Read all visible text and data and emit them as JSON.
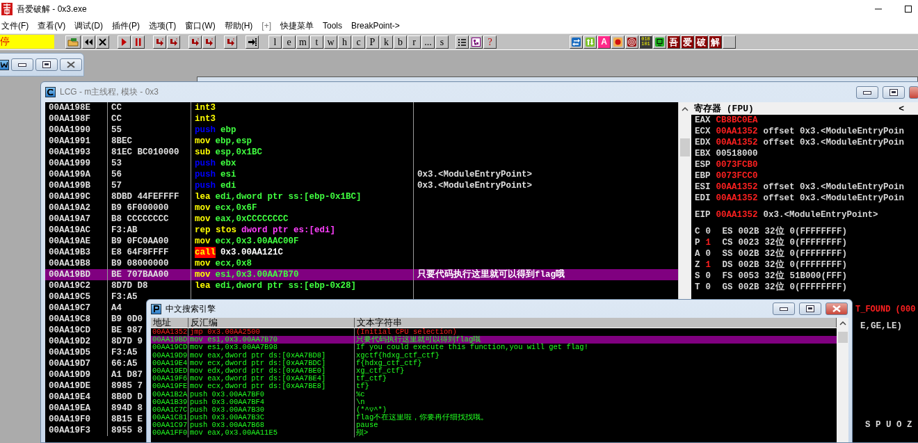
{
  "app": {
    "title": "吾爱破解 - 0x3.exe"
  },
  "menu": [
    "文件(F)",
    "查看(V)",
    "调试(D)",
    "插件(P)",
    "选项(T)",
    "窗口(W)",
    "帮助(H)",
    "[+]",
    "快捷菜单",
    "Tools",
    "BreakPoint->"
  ],
  "toolbar": {
    "status": "停",
    "letters": [
      "l",
      "e",
      "m",
      "t",
      "w",
      "h",
      "c",
      "P",
      "k",
      "b",
      "r",
      "...",
      "s"
    ],
    "help": "?",
    "letter_icon": "A",
    "binary": [
      "010",
      "101"
    ],
    "brand": [
      "吾",
      "爱",
      "破",
      "解"
    ]
  },
  "cpu_window": {
    "title": "LCG - m主线程, 模块 - 0x3",
    "rows": [
      {
        "address": "00AA198E",
        "hex": "CC",
        "op": "int3",
        "kind": "plain",
        "selected": false
      },
      {
        "address": "00AA198F",
        "hex": "CC",
        "op": "int3",
        "kind": "plain",
        "selected": false
      },
      {
        "address": "00AA1990",
        "hex": "55",
        "op": "push",
        "args": "ebp",
        "kind": "stack",
        "selected": false
      },
      {
        "address": "00AA1991",
        "hex": "8BEC",
        "op": "mov",
        "args": "ebp,esp",
        "kind": "plain",
        "selected": false
      },
      {
        "address": "00AA1993",
        "hex": "81EC BC010000",
        "op": "sub",
        "args": "esp,0x1BC",
        "kind": "plain",
        "selected": false
      },
      {
        "address": "00AA1999",
        "hex": "53",
        "op": "push",
        "args": "ebx",
        "kind": "stack",
        "selected": false
      },
      {
        "address": "00AA199A",
        "hex": "56",
        "op": "push",
        "args": "esi",
        "kind": "stack",
        "comment": "0x3.<ModuleEntryPoint>",
        "selected": false
      },
      {
        "address": "00AA199B",
        "hex": "57",
        "op": "push",
        "args": "edi",
        "kind": "stack",
        "comment": "0x3.<ModuleEntryPoint>",
        "selected": false
      },
      {
        "address": "00AA199C",
        "hex": "8DBD 44FEFFFF",
        "op": "lea",
        "args": "edi,dword ptr ss:[ebp-0x1BC]",
        "kind": "plain",
        "selected": false
      },
      {
        "address": "00AA19A2",
        "hex": "B9 6F000000",
        "op": "mov",
        "args": "ecx,0x6F",
        "kind": "plain",
        "selected": false
      },
      {
        "address": "00AA19A7",
        "hex": "B8 CCCCCCCC",
        "op": "mov",
        "args": "eax,0xCCCCCCCC",
        "kind": "plain",
        "selected": false
      },
      {
        "address": "00AA19AC",
        "hex": "F3:AB",
        "op": "rep stos",
        "args": "dword ptr es:[edi]",
        "kind": "string",
        "selected": false
      },
      {
        "address": "00AA19AE",
        "hex": "B9 0FC0AA00",
        "op": "mov",
        "args": "ecx,0x3.00AAC00F",
        "kind": "plain",
        "selected": false
      },
      {
        "address": "00AA19B3",
        "hex": "E8 64F8FFFF",
        "op": "call",
        "args": "0x3.00AA121C",
        "kind": "call",
        "selected": false
      },
      {
        "address": "00AA19B8",
        "hex": "B9 08000000",
        "op": "mov",
        "args": "ecx,0x8",
        "kind": "plain",
        "selected": false
      },
      {
        "address": "00AA19BD",
        "hex": "BE 707BAA00",
        "op": "mov",
        "args": "esi,0x3.00AA7B70",
        "kind": "plain",
        "comment": "只要代码执行这里就可以得到flag哦",
        "selected": true
      },
      {
        "address": "00AA19C2",
        "hex": "8D7D D8",
        "op": "lea",
        "args": "edi,dword ptr ss:[ebp-0x28]",
        "kind": "plain",
        "selected": false
      },
      {
        "address": "00AA19C5",
        "hex": "F3:A5",
        "selected": false
      },
      {
        "address": "00AA19C7",
        "hex": "A4",
        "selected": false
      },
      {
        "address": "00AA19C8",
        "hex": "B9 0D0",
        "selected": false
      },
      {
        "address": "00AA19CD",
        "hex": "BE 987",
        "selected": false
      },
      {
        "address": "00AA19D2",
        "hex": "8D7D 9",
        "selected": false
      },
      {
        "address": "00AA19D5",
        "hex": "F3:A5",
        "selected": false
      },
      {
        "address": "00AA19D7",
        "hex": "66:A5",
        "selected": false
      },
      {
        "address": "00AA19D9",
        "hex": "A1 D87",
        "selected": false
      },
      {
        "address": "00AA19DE",
        "hex": "8985 7",
        "selected": false
      },
      {
        "address": "00AA19E4",
        "hex": "8B0D D",
        "selected": false
      },
      {
        "address": "00AA19EA",
        "hex": "894D 8",
        "selected": false
      },
      {
        "address": "00AA19F0",
        "hex": "8B15 E",
        "selected": false
      },
      {
        "address": "00AA19F3",
        "hex": "8955 8",
        "selected": false
      }
    ],
    "registers": {
      "title": "寄存器 (FPU)",
      "toggle": "<",
      "general": [
        {
          "name": "EAX",
          "value": "CB8BC0EA",
          "changed": true
        },
        {
          "name": "ECX",
          "value": "00AA1352",
          "changed": true,
          "note": "offset 0x3.<ModuleEntryPoin"
        },
        {
          "name": "EDX",
          "value": "00AA1352",
          "changed": true,
          "note": "offset 0x3.<ModuleEntryPoin"
        },
        {
          "name": "EBX",
          "value": "00518000",
          "changed": false
        },
        {
          "name": "ESP",
          "value": "0073FCB0",
          "changed": true
        },
        {
          "name": "EBP",
          "value": "0073FCC0",
          "changed": true
        },
        {
          "name": "ESI",
          "value": "00AA1352",
          "changed": true,
          "note": "offset 0x3.<ModuleEntryPoin"
        },
        {
          "name": "EDI",
          "value": "00AA1352",
          "changed": true,
          "note": "offset 0x3.<ModuleEntryPoin"
        }
      ],
      "eip": {
        "name": "EIP",
        "value": "00AA1352",
        "changed": true,
        "note": "0x3.<ModuleEntryPoint>"
      },
      "flags": [
        {
          "flag": "C",
          "bit": "0",
          "changed": false,
          "segment": "ES",
          "selector": "002B",
          "width": "32位",
          "limit": "0(FFFFFFFF)"
        },
        {
          "flag": "P",
          "bit": "1",
          "changed": true,
          "segment": "CS",
          "selector": "0023",
          "width": "32位",
          "limit": "0(FFFFFFFF)"
        },
        {
          "flag": "A",
          "bit": "0",
          "changed": false,
          "segment": "SS",
          "selector": "002B",
          "width": "32位",
          "limit": "0(FFFFFFFF)"
        },
        {
          "flag": "Z",
          "bit": "1",
          "changed": true,
          "segment": "DS",
          "selector": "002B",
          "width": "32位",
          "limit": "0(FFFFFFFF)"
        },
        {
          "flag": "S",
          "bit": "0",
          "changed": false,
          "segment": "FS",
          "selector": "0053",
          "width": "32位",
          "limit": "51B000(FFF)"
        },
        {
          "flag": "T",
          "bit": "0",
          "changed": false,
          "segment": "GS",
          "selector": "002B",
          "width": "32位",
          "limit": "0(FFFFFFFF)"
        }
      ],
      "fragments": [
        {
          "text": "T_FOUND (000",
          "changed": true
        },
        {
          "text": "E,GE,LE)",
          "changed": false
        },
        {
          "text": "S P U O Z",
          "changed": false
        }
      ]
    }
  },
  "search_window": {
    "title": "中文搜索引擎",
    "columns": [
      "地址",
      "反汇编",
      "文本字符串"
    ],
    "rows": [
      {
        "address": "00AA1352",
        "code": "jmp 0x3.00AA2500",
        "text": "(Initial CPU selection)",
        "kind": "initial",
        "selected": false
      },
      {
        "address": "00AA19BD",
        "code": "mov esi,0x3.00AA7B70",
        "text": "只要代码执行这里就可以得到flag哦",
        "kind": "normal",
        "selected": true
      },
      {
        "address": "00AA19CD",
        "code": "mov esi,0x3.00AA7B98",
        "text": "If you could execute this function,you will get flag!",
        "kind": "normal",
        "selected": false
      },
      {
        "address": "00AA19D9",
        "code": "mov eax,dword ptr ds:[0xAA7BD8]",
        "text": "xgctf{hdxg_ctf_ctf}",
        "kind": "normal",
        "selected": false
      },
      {
        "address": "00AA19E4",
        "code": "mov ecx,dword ptr ds:[0xAA7BDC]",
        "text": "f{hdxg_ctf_ctf}",
        "kind": "normal",
        "selected": false
      },
      {
        "address": "00AA19ED",
        "code": "mov edx,dword ptr ds:[0xAA7BE0]",
        "text": "xg_ctf_ctf}",
        "kind": "normal",
        "selected": false
      },
      {
        "address": "00AA19F6",
        "code": "mov eax,dword ptr ds:[0xAA7BE4]",
        "text": "tf_ctf}",
        "kind": "normal",
        "selected": false
      },
      {
        "address": "00AA19FE",
        "code": "mov ecx,dword ptr ds:[0xAA7BE8]",
        "text": "tf}",
        "kind": "normal",
        "selected": false
      },
      {
        "address": "00AA1B2A",
        "code": "push 0x3.00AA7BF0",
        "text": "%c",
        "kind": "normal",
        "selected": false
      },
      {
        "address": "00AA1B39",
        "code": "push 0x3.00AA7BF4",
        "text": "\\n",
        "kind": "normal",
        "selected": false
      },
      {
        "address": "00AA1C7C",
        "code": "push 0x3.00AA7B30",
        "text": "(*^▽^*)",
        "kind": "normal",
        "selected": false
      },
      {
        "address": "00AA1C81",
        "code": "push 0x3.00AA7B3C",
        "text": "flag不在这里啦，你要再仔细找找哦。",
        "kind": "normal",
        "selected": false
      },
      {
        "address": "00AA1C97",
        "code": "push 0x3.00AA7B68",
        "text": "pause",
        "kind": "normal",
        "selected": false
      },
      {
        "address": "00AA1FF0",
        "code": "mov eax,0x3.00AA11E5",
        "text": "殒>",
        "kind": "normal",
        "selected": false
      }
    ]
  }
}
